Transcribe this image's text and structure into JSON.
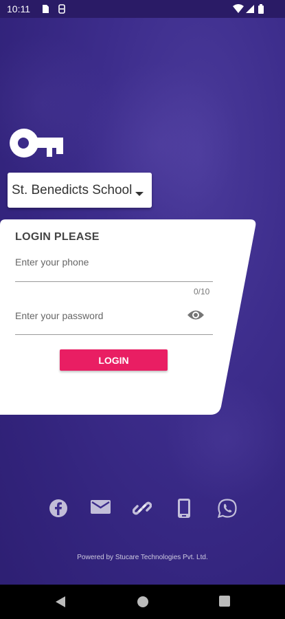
{
  "status_bar": {
    "time": "10:11"
  },
  "school_select": {
    "selected": "St. Benedicts School"
  },
  "login": {
    "title": "LOGIN PLEASE",
    "phone_placeholder": "Enter your phone",
    "phone_counter": "0/10",
    "password_placeholder": "Enter your password",
    "button_label": "LOGIN"
  },
  "social": [
    "facebook-icon",
    "email-icon",
    "link-icon",
    "phone-icon",
    "whatsapp-icon"
  ],
  "footer": {
    "powered_by": "Powered by Stucare Technologies Pvt. Ltd."
  },
  "colors": {
    "background": "#3d2d8c",
    "accent": "#e91e63",
    "card": "#ffffff"
  }
}
